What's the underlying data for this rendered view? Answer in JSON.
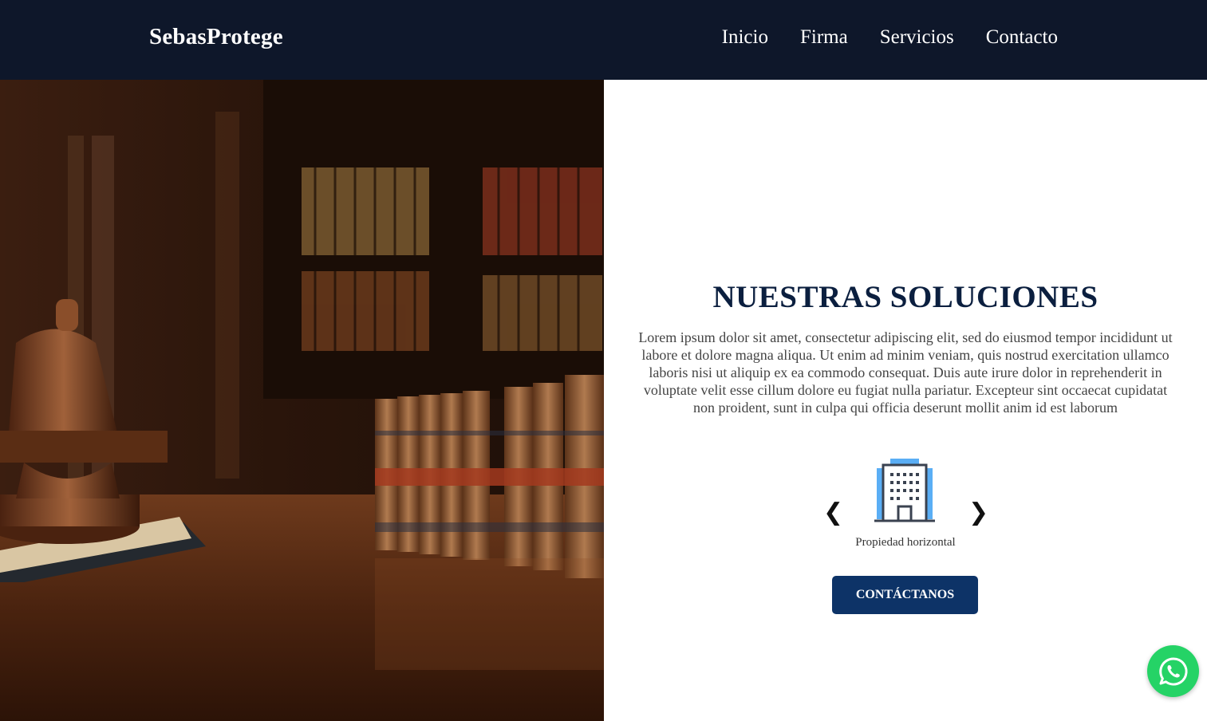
{
  "header": {
    "brand": "SebasProtege",
    "nav": [
      {
        "label": "Inicio"
      },
      {
        "label": "Firma"
      },
      {
        "label": "Servicios"
      },
      {
        "label": "Contacto"
      }
    ]
  },
  "hero": {
    "image_icon": "law-library-gavel-image"
  },
  "solutions": {
    "title": "NUESTRAS SOLUCIONES",
    "description": "Lorem ipsum dolor sit amet, consectetur adipiscing elit, sed do eiusmod tempor incididunt ut labore et dolore magna aliqua. Ut enim ad minim veniam, quis nostrud exercitation ullamco laboris nisi ut aliquip ex ea commodo consequat. Duis aute irure dolor in reprehenderit in voluptate velit esse cillum dolore eu fugiat nulla pariatur. Excepteur sint occaecat cupidatat non proident, sunt in culpa qui officia deserunt mollit anim id est laborum",
    "carousel": {
      "prev_glyph": "❮",
      "next_glyph": "❯",
      "item_icon": "building-icon",
      "caption": "Propiedad horizontal"
    },
    "cta_label": "CONTÁCTANOS"
  },
  "whatsapp": {
    "icon": "whatsapp-icon"
  },
  "colors": {
    "navbar": "#0e172a",
    "title": "#0b1f3f",
    "cta": "#0d3367",
    "whatsapp": "#25d366"
  }
}
